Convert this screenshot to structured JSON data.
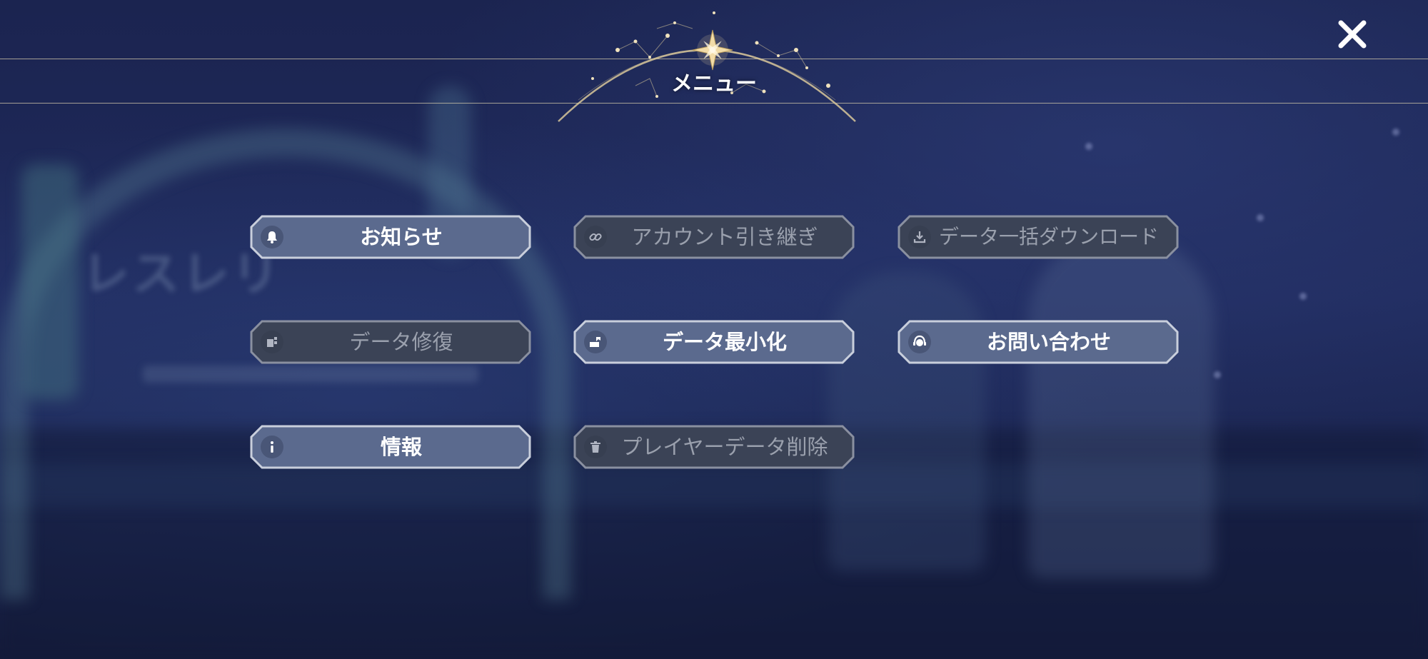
{
  "header": {
    "title": "メニュー",
    "emblem_icon": "compass-star-icon",
    "close_icon": "close-icon"
  },
  "background": {
    "logo_text": "レスレリ"
  },
  "colors": {
    "enabled_fill": "#5b6a8e",
    "disabled_fill": "#3b4356",
    "frame_stroke": "#c9cfdc",
    "accent_gold": "#e9d3a0"
  },
  "menu": {
    "items": [
      {
        "label": "お知らせ",
        "icon": "bell-icon",
        "enabled": true
      },
      {
        "label": "アカウント引き継ぎ",
        "icon": "link-icon",
        "enabled": false
      },
      {
        "label": "データ一括ダウンロード",
        "icon": "download-icon",
        "enabled": false
      },
      {
        "label": "データ修復",
        "icon": "data-repair-icon",
        "enabled": false
      },
      {
        "label": "データ最小化",
        "icon": "data-minimize-icon",
        "enabled": true
      },
      {
        "label": "お問い合わせ",
        "icon": "support-headset-icon",
        "enabled": true
      },
      {
        "label": "情報",
        "icon": "info-icon",
        "enabled": true
      },
      {
        "label": "プレイヤーデータ削除",
        "icon": "trash-icon",
        "enabled": false
      }
    ]
  }
}
